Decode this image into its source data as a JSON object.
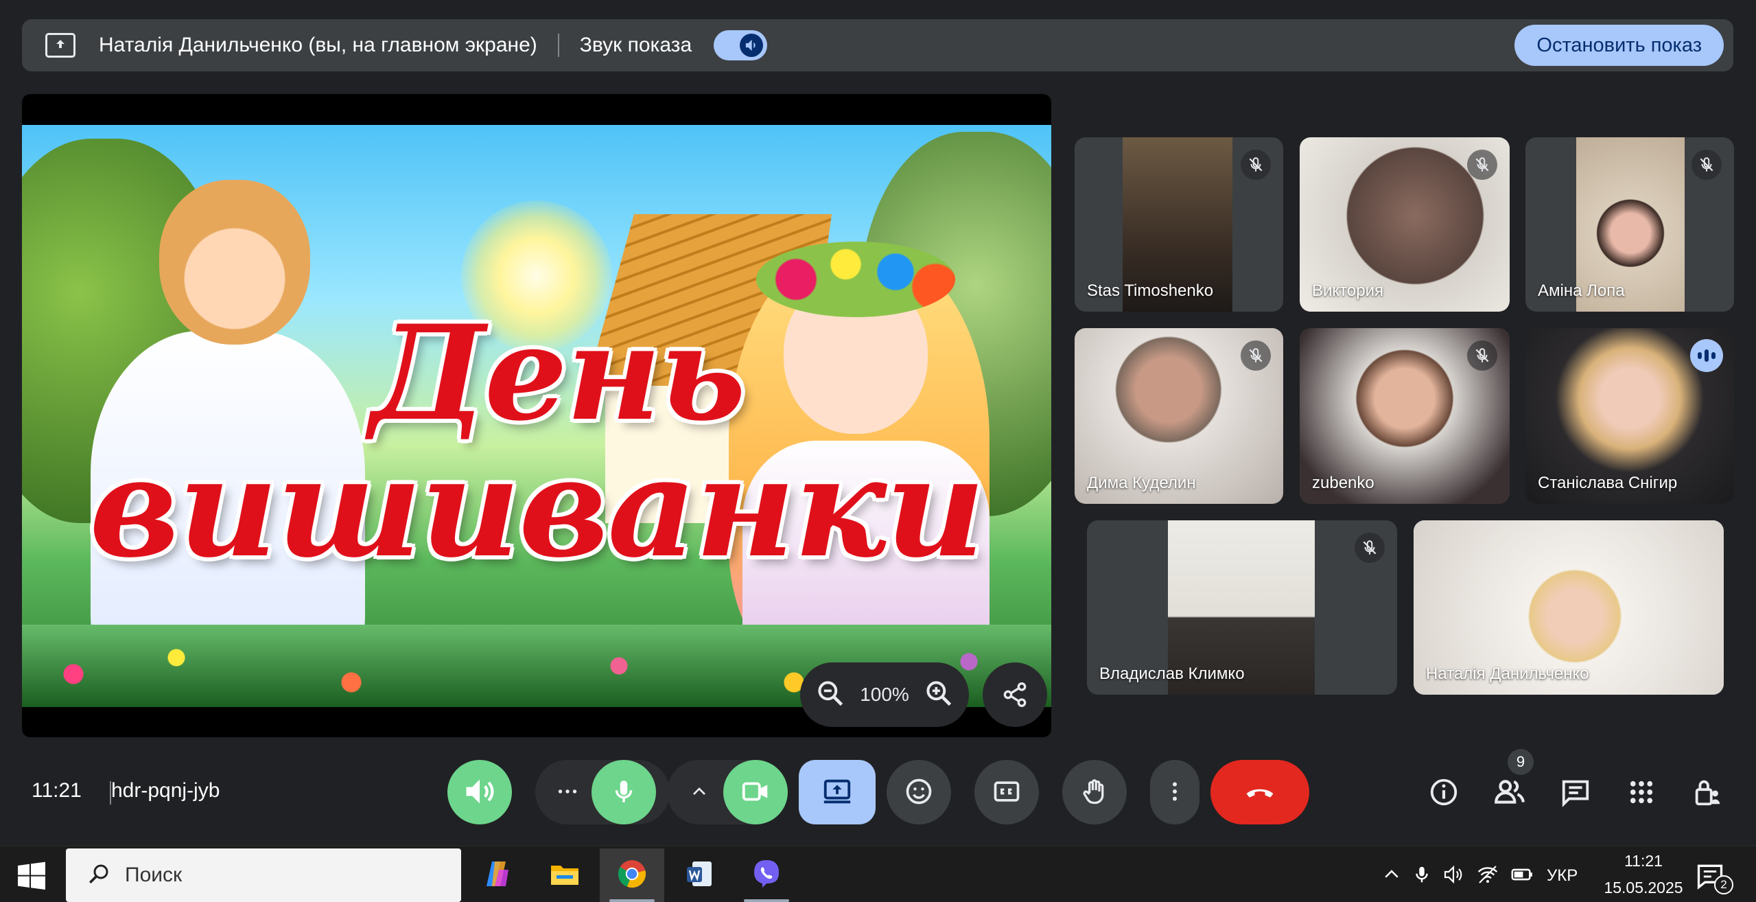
{
  "banner": {
    "presenter_text": "Наталія Данильченко (вы, на главном экране)",
    "sound_label": "Звук показа",
    "stop_label": "Остановить показ"
  },
  "presentation": {
    "slide_title_line1": "День",
    "slide_title_line2": "вишиванки",
    "zoom_level": "100%"
  },
  "participants": [
    {
      "name": "Stas Timoshenko",
      "muted": true
    },
    {
      "name": "Виктория",
      "muted": true
    },
    {
      "name": "Аміна Лопа",
      "muted": true
    },
    {
      "name": "Дима Куделин",
      "muted": true
    },
    {
      "name": "zubenko",
      "muted": true
    },
    {
      "name": "Станіслава Снігир",
      "muted": false,
      "speaking": true
    },
    {
      "name": "Владислав Климко",
      "muted": true
    },
    {
      "name": "Наталія Данильченко",
      "muted": false,
      "self": true
    }
  ],
  "meeting": {
    "time": "11:21",
    "code": "hdr-pqnj-jyb",
    "people_count": "9"
  },
  "taskbar": {
    "search_placeholder": "Поиск",
    "language": "УКР",
    "clock_time": "11:21",
    "clock_date": "15.05.2025",
    "notification_count": "2"
  },
  "colors": {
    "accent": "#a8c7fa",
    "green": "#6dd58c",
    "end_call": "#e3281f",
    "panel": "#3c4043",
    "background": "#202124"
  }
}
